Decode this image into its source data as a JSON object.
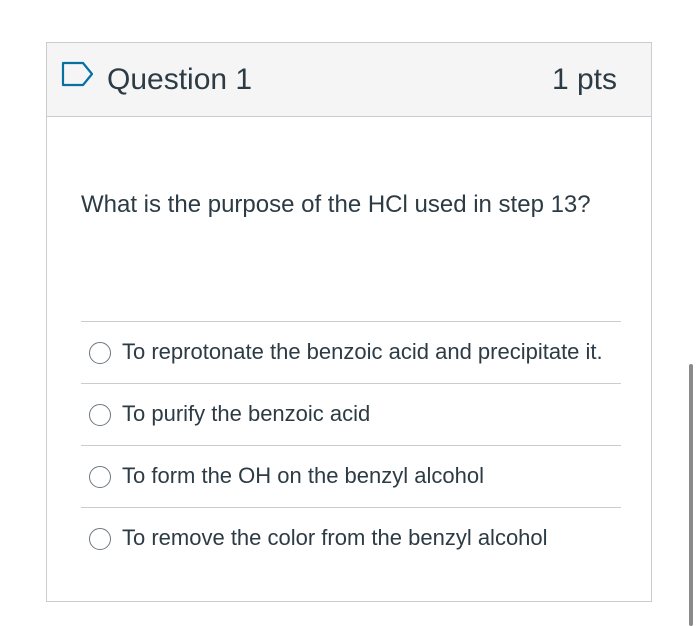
{
  "question": {
    "title": "Question 1",
    "points": "1 pts",
    "text": "What is the purpose of the HCl used in step 13?",
    "flag_icon": "flag-outline-icon"
  },
  "answers": [
    {
      "label": "To reprotonate the benzoic acid and precipitate it.",
      "selected": false
    },
    {
      "label": "To purify the benzoic acid",
      "selected": false
    },
    {
      "label": "To form the OH on the benzyl alcohol",
      "selected": false
    },
    {
      "label": "To remove the color from the benzyl alcohol",
      "selected": false
    }
  ],
  "colors": {
    "text": "#2d3b45",
    "border": "#c7cdd1",
    "header_bg": "#f5f5f5",
    "flag": "#0770a3"
  }
}
